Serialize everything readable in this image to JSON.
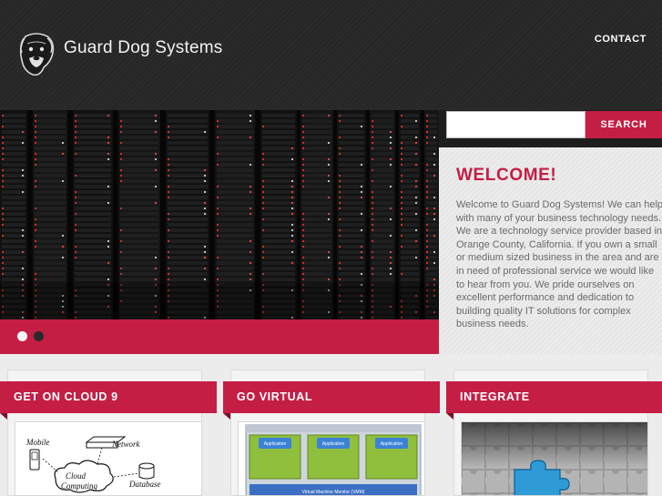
{
  "header": {
    "brand": "Guard Dog Systems",
    "nav": {
      "contact": "CONTACT"
    }
  },
  "slider": {
    "active_index": 0,
    "dot_count": 2
  },
  "search": {
    "placeholder": "",
    "button_label": "SEARCH"
  },
  "welcome": {
    "title": "WELCOME!",
    "body": "Welcome to Guard Dog Systems! We can help with many of your business technology needs.  We are a technology service provider based in Orange County, California.   If you own a small or medium sized business in the area and are in need of professional service we would like to hear from you.  We pride ourselves on excellent performance and dedication to building quality IT solutions for complex business needs."
  },
  "cards": [
    {
      "title": "GET ON CLOUD 9",
      "image": {
        "labels": [
          "Mobile",
          "Network",
          "Cloud Computing",
          "Database"
        ]
      }
    },
    {
      "title": "GO VIRTUAL",
      "image": {
        "labels": [
          "Application",
          "Application",
          "Application",
          "Virtual Machine Monitor (VMM)"
        ]
      }
    },
    {
      "title": "INTEGRATE",
      "image": {
        "labels": []
      }
    }
  ],
  "colors": {
    "accent": "#c41e45",
    "header_bg": "#2a2a2a",
    "text_gray": "#6a6a6a"
  }
}
